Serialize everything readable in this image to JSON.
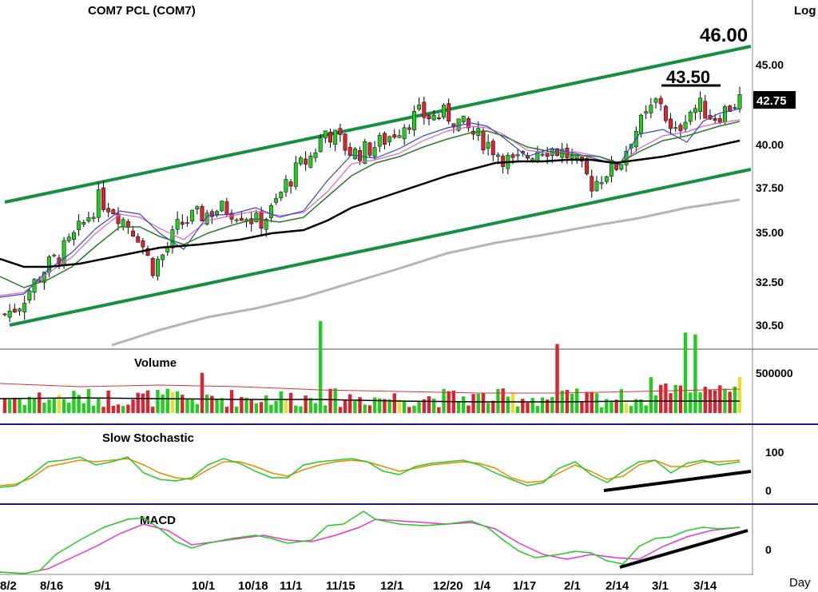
{
  "chart_data": {
    "type": "candlestick",
    "title": "COM7  PCL  (COM7)",
    "scale_label": "Log",
    "period_label": "Day",
    "price_axis": {
      "ticks": [
        "45.00",
        "40.00",
        "37.50",
        "35.00",
        "32.50",
        "30.50"
      ],
      "scale": "log"
    },
    "x_ticks": [
      "8/2",
      "8/16",
      "9/1",
      "10/1",
      "10/18",
      "11/1",
      "11/15",
      "12/1",
      "12/20",
      "1/4",
      "1/17",
      "2/1",
      "2/14",
      "3/1",
      "3/14"
    ],
    "annotations": {
      "target": "46.00",
      "high": "43.50",
      "last_price": "42.75"
    },
    "price_series": [
      31.0,
      31.4,
      32.3,
      33.2,
      33.8,
      34.6,
      35.6,
      36.8,
      36.4,
      35.6,
      34.9,
      33.2,
      34.0,
      35.4,
      35.8,
      36.0,
      36.3,
      36.2,
      36.0,
      35.5,
      36.2,
      37.6,
      38.6,
      39.3,
      40.8,
      40.2,
      39.4,
      39.6,
      40.0,
      40.6,
      41.3,
      41.8,
      41.6,
      41.8,
      41.3,
      40.6,
      40.1,
      39.4,
      38.8,
      39.2,
      39.8,
      39.7,
      39.4,
      38.6,
      37.6,
      38.4,
      38.8,
      40.6,
      41.6,
      42.9,
      40.2,
      41.9,
      42.3,
      41.6,
      42.1,
      42.75
    ],
    "channel": {
      "upper": [
        36.8,
        46.0
      ],
      "lower": [
        30.5,
        38.6
      ]
    },
    "volume": {
      "label": "Volume",
      "ticks": [
        "500000"
      ],
      "spikes": [
        420000,
        960000,
        720000,
        840000,
        820000
      ]
    },
    "stochastic": {
      "label": "Slow  Stochastic",
      "ticks": [
        "100",
        "0"
      ]
    },
    "macd": {
      "label": "MACD",
      "ticks": [
        "0"
      ]
    },
    "colors": {
      "up": "#22cc22",
      "down": "#dd2233",
      "channel": "#159040",
      "ema200": "#b5b5b5",
      "ema50": "#000000",
      "ema20": "#2a7a2a",
      "ema10": "#e060c0",
      "ema5": "#3344cc",
      "stoch_k": "#22cc22",
      "stoch_d": "#ee8800",
      "macd": "#22cc22",
      "signal": "#ee33cc"
    }
  }
}
